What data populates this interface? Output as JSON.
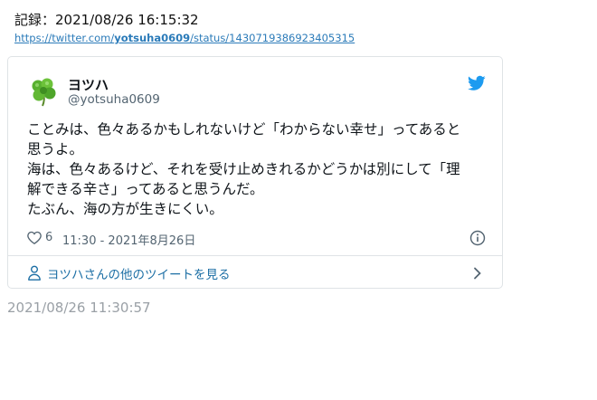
{
  "record": {
    "title": "記録：2021/08/26 16:15:32",
    "link_prefix": "https://twitter.com/",
    "link_user": "yotsuha0609",
    "link_suffix": "/status/1430719386923405315"
  },
  "tweet": {
    "author_name": "ヨツハ",
    "author_handle": "@yotsuha0609",
    "avatar_icon": "clover-avatar",
    "brand_icon": "twitter-bird-icon",
    "brand_color": "#1d9bf0",
    "text_lines": [
      "ことみは、色々あるかもしれないけど「わからない幸せ」ってあると",
      "思うよ。",
      "海は、色々あるけど、それを受け止めきれるかどうかは別にして「理",
      "解できる辛さ」ってあると思うんだ。",
      "たぶん、海の方が生きにくい。"
    ],
    "like_count": "6",
    "timestamp": "11:30 - 2021年8月26日",
    "more_label": "ヨツハさんの他のツイートを見る"
  },
  "footer": {
    "saved_time": "2021/08/26 11:30:57"
  }
}
